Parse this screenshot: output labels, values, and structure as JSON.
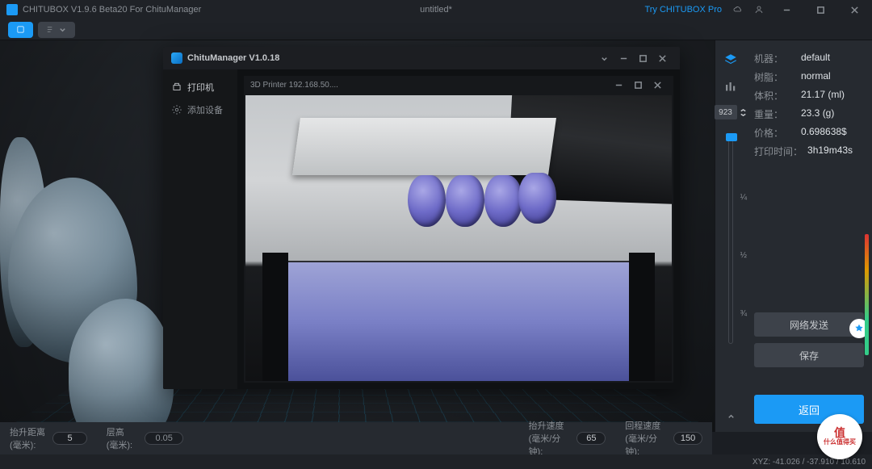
{
  "titlebar": {
    "app": "CHITUBOX V1.9.6 Beta20 For ChituManager",
    "doc": "untitled*",
    "pro": "Try CHITUBOX Pro"
  },
  "toolbar": {
    "tab_main": "",
    "tab_second": ""
  },
  "modal": {
    "title": "ChituManager V1.0.18",
    "side": {
      "printer": "打印机",
      "add_device": "添加设备"
    },
    "camera_title": "3D Printer 192.168.50...."
  },
  "slider": {
    "input": "923",
    "tick1": "¼",
    "tick2": "½",
    "tick3": "¾"
  },
  "info": {
    "machine_label": "机器：",
    "machine": "default",
    "resin_label": "树脂：",
    "resin": "normal",
    "volume_label": "体积：",
    "volume": "21.17  (ml)",
    "weight_label": "重量：",
    "weight": "23.3  (g)",
    "price_label": "价格：",
    "price": "0.698638$",
    "time_label": "打印时间：",
    "time": "3h19m43s"
  },
  "buttons": {
    "network_send": "网络发送",
    "save": "保存",
    "back": "返回"
  },
  "params": {
    "lift_dist_label": "抬升距离(毫米):",
    "lift_dist": "5",
    "layer_h_label": "层高 (毫米):",
    "layer_h": "0.05",
    "lift_speed_label": "抬升速度 (毫米/分钟):",
    "lift_speed": "65",
    "retract_speed_label": "回程速度 (毫米/分钟):",
    "retract_speed": "150"
  },
  "status": {
    "xyz": "XYZ: -41.026  / -37.910  / 10.610"
  },
  "watermark": {
    "top": "值",
    "bottom": "什么值得买"
  }
}
